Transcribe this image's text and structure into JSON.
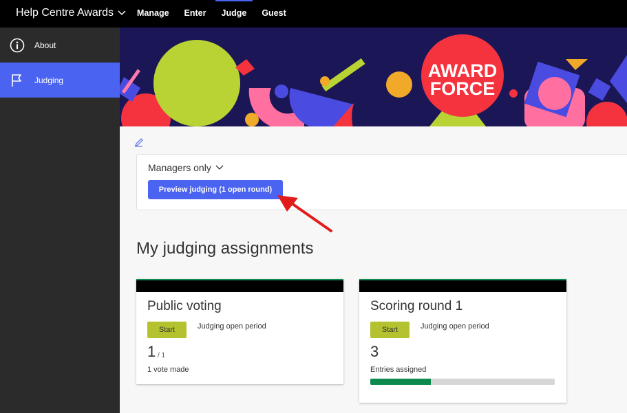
{
  "app": {
    "title": "Help Centre Awards"
  },
  "nav": {
    "items": [
      {
        "label": "Manage"
      },
      {
        "label": "Enter"
      },
      {
        "label": "Judge"
      },
      {
        "label": "Guest"
      }
    ],
    "active": "Judge"
  },
  "sidebar": {
    "items": [
      {
        "label": "About",
        "icon": "info-icon"
      },
      {
        "label": "Judging",
        "icon": "flag-icon"
      }
    ],
    "active": "Judging"
  },
  "banner": {
    "logo_line1": "AWARD",
    "logo_line2": "FORCE"
  },
  "preview": {
    "audience_label": "Managers only",
    "button_label": "Preview judging (1 open round)"
  },
  "assignments": {
    "title": "My judging assignments",
    "cards": [
      {
        "title": "Public voting",
        "start_label": "Start",
        "period": "Judging open period",
        "count": "1",
        "count_total": "/ 1",
        "caption": "1 vote made"
      },
      {
        "title": "Scoring round 1",
        "start_label": "Start",
        "period": "Judging open period",
        "count": "3",
        "caption": "Entries assigned",
        "progress": 0.33
      }
    ]
  },
  "colors": {
    "accent": "#4a63f0",
    "start_button": "#b5c230",
    "progress": "#0d8a4e",
    "banner_bg": "#1b1655"
  }
}
